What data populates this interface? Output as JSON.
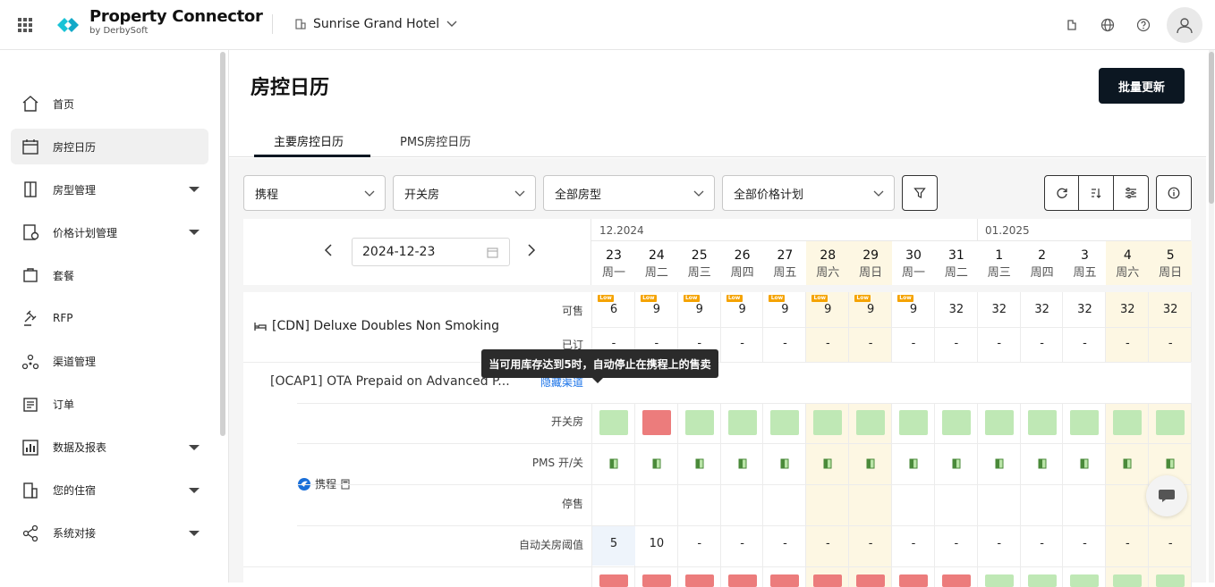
{
  "brand": {
    "name": "Property Connector",
    "sub": "by DerbySoft"
  },
  "hotel": {
    "name": "Sunrise Grand Hotel"
  },
  "sidebar": {
    "items": [
      {
        "label": "首页",
        "icon": "home-icon",
        "has_children": false
      },
      {
        "label": "房控日历",
        "icon": "calendar-icon",
        "has_children": false,
        "active": true
      },
      {
        "label": "房型管理",
        "icon": "door-icon",
        "has_children": true
      },
      {
        "label": "价格计划管理",
        "icon": "price-plan-icon",
        "has_children": true
      },
      {
        "label": "套餐",
        "icon": "package-icon",
        "has_children": false
      },
      {
        "label": "RFP",
        "icon": "gavel-icon",
        "has_children": false
      },
      {
        "label": "渠道管理",
        "icon": "channels-icon",
        "has_children": false
      },
      {
        "label": "订单",
        "icon": "orders-icon",
        "has_children": false
      },
      {
        "label": "数据及报表",
        "icon": "chart-icon",
        "has_children": true
      },
      {
        "label": "您的住宿",
        "icon": "building-icon",
        "has_children": true
      },
      {
        "label": "系统对接",
        "icon": "share-icon",
        "has_children": true
      }
    ]
  },
  "page": {
    "title": "房控日历",
    "bulk_update": "批量更新"
  },
  "tabs": [
    {
      "label": "主要房控日历",
      "active": true
    },
    {
      "label": "PMS房控日历",
      "active": false
    }
  ],
  "filters": {
    "channel": "携程",
    "open_close": "开关房",
    "room_type": "全部房型",
    "rate_plan": "全部价格计划"
  },
  "calendar": {
    "date": "2024-12-23",
    "months": [
      {
        "label": "12.2024"
      },
      {
        "label": "01.2025"
      }
    ],
    "days": [
      {
        "d": "23",
        "w": "周一",
        "wk": false
      },
      {
        "d": "24",
        "w": "周二",
        "wk": false
      },
      {
        "d": "25",
        "w": "周三",
        "wk": false
      },
      {
        "d": "26",
        "w": "周四",
        "wk": false
      },
      {
        "d": "27",
        "w": "周五",
        "wk": false
      },
      {
        "d": "28",
        "w": "周六",
        "wk": true
      },
      {
        "d": "29",
        "w": "周日",
        "wk": true
      },
      {
        "d": "30",
        "w": "周一",
        "wk": false
      },
      {
        "d": "31",
        "w": "周二",
        "wk": false
      },
      {
        "d": "1",
        "w": "周三",
        "wk": false
      },
      {
        "d": "2",
        "w": "周四",
        "wk": false
      },
      {
        "d": "3",
        "w": "周五",
        "wk": false
      },
      {
        "d": "4",
        "w": "周六",
        "wk": true
      },
      {
        "d": "5",
        "w": "周日",
        "wk": true
      }
    ]
  },
  "room": {
    "name": "[CDN] Deluxe Doubles Non Smoking",
    "labels": {
      "available": "可售",
      "booked": "已订",
      "open_close": "开关房",
      "pms": "PMS 开/关",
      "stop_sell": "停售",
      "auto_close": "自动关房阈值"
    },
    "low_badge": "Low",
    "available": [
      "6",
      "9",
      "9",
      "9",
      "9",
      "9",
      "9",
      "9",
      "32",
      "32",
      "32",
      "32",
      "32",
      "32"
    ],
    "low": [
      true,
      true,
      true,
      true,
      true,
      true,
      true,
      true,
      false,
      false,
      false,
      false,
      false,
      false
    ],
    "booked": [
      "-",
      "-",
      "-",
      "-",
      "-",
      "-",
      "-",
      "-",
      "-",
      "-",
      "-",
      "-",
      "-",
      "-"
    ],
    "rate_plan": "[OCAP1] OTA Prepaid on Advanced P...",
    "hide_channel": "隐藏渠道",
    "channel": "携程",
    "open_status": [
      "open",
      "closed",
      "open",
      "open",
      "open",
      "open",
      "open",
      "open",
      "open",
      "open",
      "open",
      "open",
      "open",
      "open"
    ],
    "auto_close": [
      "5",
      "10",
      "-",
      "-",
      "-",
      "-",
      "-",
      "-",
      "-",
      "-",
      "-",
      "-",
      "-",
      "-"
    ],
    "next_row_status": [
      "closed",
      "closed",
      "closed",
      "closed",
      "closed",
      "closed",
      "closed",
      "closed",
      "closed",
      "open",
      "open",
      "open",
      "open",
      "open"
    ]
  },
  "tooltip": "当可用库存达到5时，自动停止在携程上的售卖"
}
